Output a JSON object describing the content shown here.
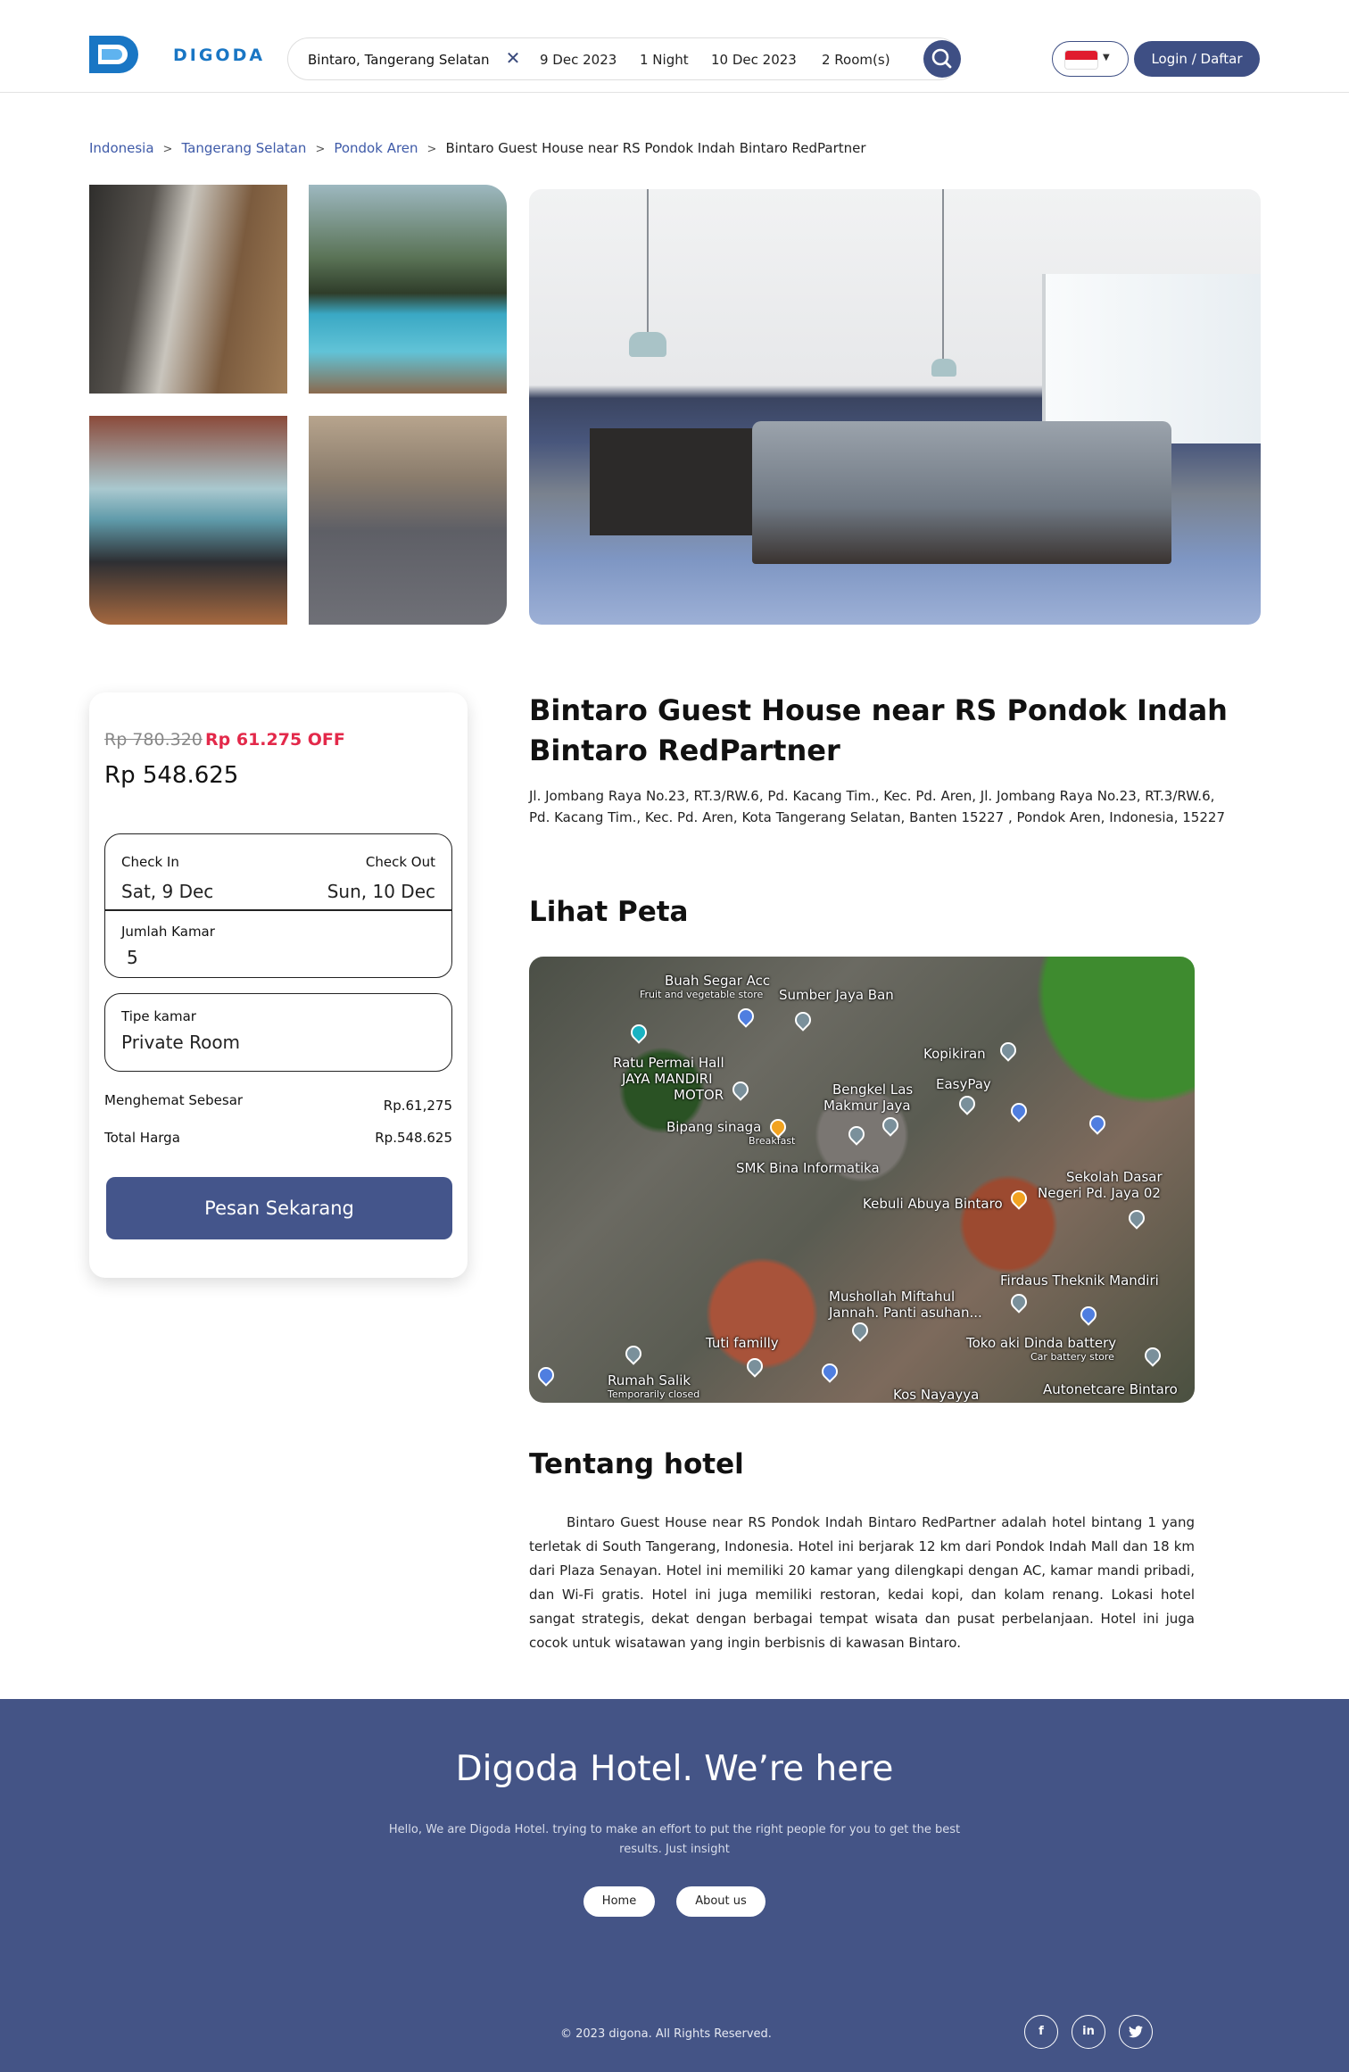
{
  "header": {
    "logo_text": "DIGODA",
    "search": {
      "location": "Bintaro, Tangerang Selatan",
      "clear_icon": "close-icon",
      "check_in": "9 Dec 2023",
      "nights": "1 Night",
      "check_out": "10 Dec 2023",
      "rooms": "2 Room(s)",
      "search_icon": "search-icon"
    },
    "language_flag": "indonesia-flag-icon",
    "login_label": "Login / Daftar"
  },
  "breadcrumb": {
    "items": [
      "Indonesia",
      "Tangerang Selatan",
      "Pondok Aren"
    ],
    "current": "Bintaro Guest House near RS Pondok Indah Bintaro RedPartner"
  },
  "gallery": {
    "images": [
      "bathroom-photo",
      "pool-photo",
      "gym-photo",
      "basketball-court-photo",
      "bedroom-photo"
    ]
  },
  "booking": {
    "old_price": "Rp 780.320",
    "discount": "Rp 61.275 OFF",
    "price": "Rp 548.625",
    "check_in_label": "Check In",
    "check_in_value": "Sat, 9 Dec",
    "check_out_label": "Check Out",
    "check_out_value": "Sun, 10 Dec",
    "rooms_label": "Jumlah Kamar",
    "rooms_value": "5",
    "room_type_label": "Tipe kamar",
    "room_type_value": "Private Room",
    "savings_label": "Menghemat Sebesar",
    "savings_value": "Rp.61,275",
    "total_label": "Total Harga",
    "total_value": "Rp.548.625",
    "book_button": "Pesan Sekarang"
  },
  "hotel": {
    "name": "Bintaro Guest House near RS Pondok Indah Bintaro RedPartner",
    "address": "Jl. Jombang Raya No.23, RT.3/RW.6, Pd. Kacang Tim., Kec. Pd. Aren, Jl. Jombang Raya No.23, RT.3/RW.6, Pd. Kacang Tim., Kec. Pd. Aren, Kota Tangerang Selatan, Banten 15227 , Pondok Aren, Indonesia, 15227"
  },
  "map": {
    "title": "Lihat Peta",
    "labels": {
      "buah_segar": "Buah Segar Acc",
      "buah_segar_sub": "Fruit and vegetable store",
      "sumber_jaya": "Sumber Jaya Ban",
      "ratu_permai": "Ratu Permai Hall",
      "jaya_mandiri": "JAYA MANDIRI",
      "motor": "MOTOR",
      "kopikiran": "Kopikiran",
      "easypay": "EasyPay",
      "bengkel_las": "Bengkel Las",
      "makmur_jaya": "Makmur Jaya",
      "bipang": "Bipang sinaga",
      "bipang_sub": "Breakfast",
      "smk": "SMK Bina Informatika",
      "kebuli": "Kebuli Abuya Bintaro",
      "sekolah_dasar": "Sekolah Dasar",
      "negeri": "Negeri Pd. Jaya 02",
      "firdaus": "Firdaus Theknik Mandiri",
      "mushollah": "Mushollah Miftahul",
      "jannah": "Jannah. Panti asuhan...",
      "tuti": "Tuti familly",
      "toko_aki": "Toko aki Dinda battery",
      "toko_aki_sub": "Car battery store",
      "rumah_salik": "Rumah Salik",
      "rumah_salik_sub": "Temporarily closed",
      "kos": "Kos Nayayya",
      "autonetcare": "Autonetcare Bintaro"
    }
  },
  "about": {
    "title": "Tentang hotel",
    "text": "Bintaro Guest House near RS Pondok Indah Bintaro RedPartner adalah hotel bintang 1 yang terletak di South Tangerang, Indonesia. Hotel ini berjarak 12 km dari Pondok Indah Mall dan 18 km dari Plaza Senayan. Hotel ini memiliki 20 kamar yang dilengkapi dengan AC, kamar mandi pribadi, dan Wi-Fi gratis. Hotel ini juga memiliki restoran, kedai kopi, dan kolam renang. Lokasi hotel sangat strategis, dekat dengan berbagai tempat wisata dan pusat perbelanjaan. Hotel ini juga cocok untuk wisatawan yang ingin berbisnis di kawasan Bintaro."
  },
  "footer": {
    "title": "Digoda Hotel. We’re here",
    "text": "Hello, We are Digoda Hotel. trying to make an effort to put the right people for you to get the best results. Just insight",
    "home": "Home",
    "about_us": "About us",
    "copyright": "© 2023 digona. All Rights Reserved.",
    "social": {
      "facebook": "f",
      "linkedin": "in",
      "twitter": "twitter-icon"
    }
  },
  "colors": {
    "primary": "#3e4f84",
    "footer_bg": "#445486",
    "discount": "#e3294a",
    "logo": "#1976c4",
    "link": "#3e5aa8"
  }
}
